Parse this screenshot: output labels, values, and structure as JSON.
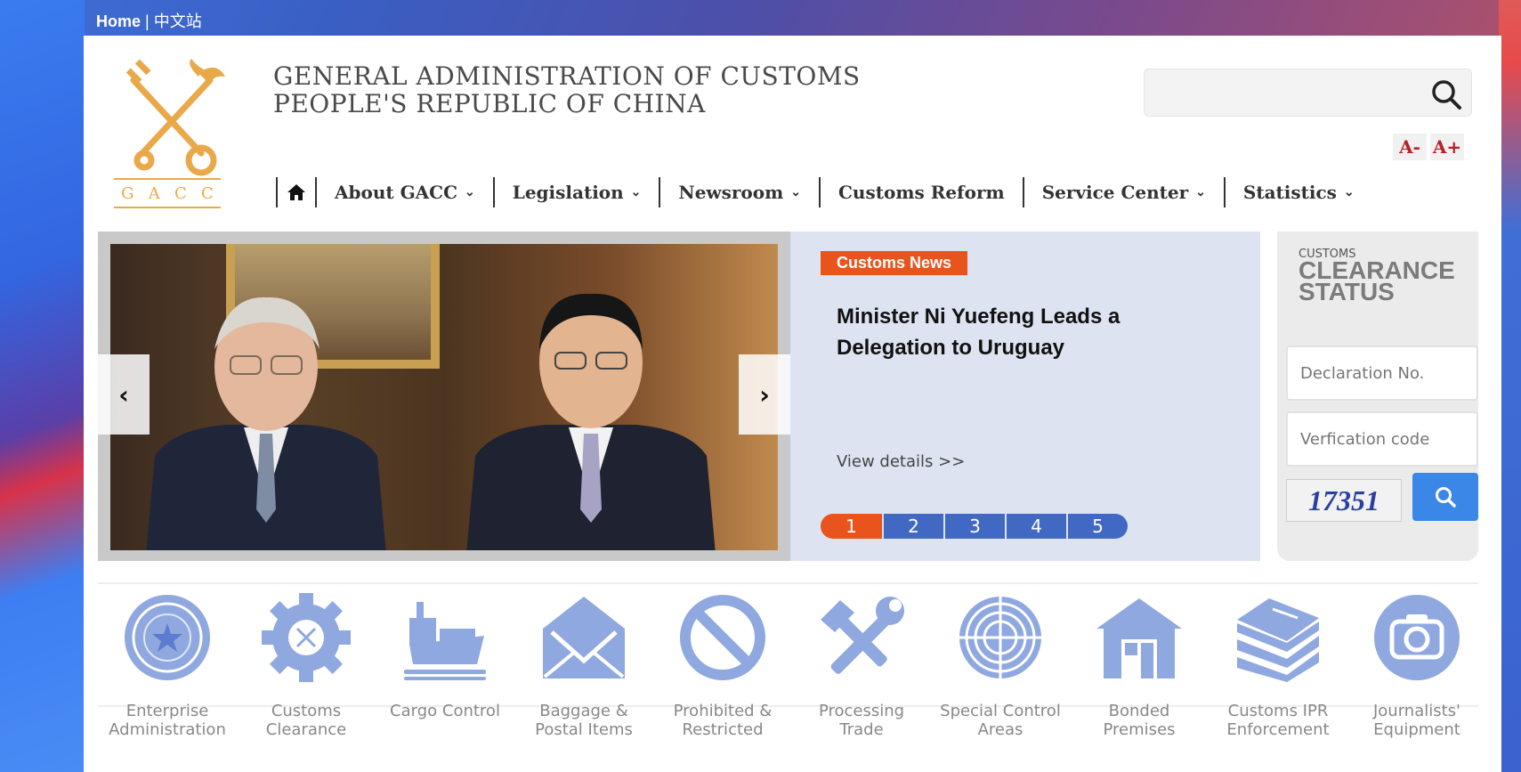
{
  "topbar": {
    "home": "Home",
    "separator": "|",
    "chinese_site": "中文站"
  },
  "header": {
    "org_line1": "GENERAL ADMINISTRATION OF CUSTOMS",
    "org_line2": "PEOPLE'S REPUBLIC OF CHINA",
    "logo_letters": [
      "G",
      "A",
      "C",
      "C"
    ],
    "search_placeholder": "",
    "font_decrease": "A-",
    "font_increase": "A+"
  },
  "nav": {
    "items": [
      {
        "label": "About GACC",
        "has_dropdown": true
      },
      {
        "label": "Legislation",
        "has_dropdown": true
      },
      {
        "label": "Newsroom",
        "has_dropdown": true
      },
      {
        "label": "Customs Reform",
        "has_dropdown": false
      },
      {
        "label": "Service Center",
        "has_dropdown": true
      },
      {
        "label": "Statistics",
        "has_dropdown": true
      }
    ]
  },
  "news": {
    "tag": "Customs News",
    "title": "Minister Ni Yuefeng Leads a Delegation to Uruguay",
    "more": "View details >>",
    "pages": [
      "1",
      "2",
      "3",
      "4",
      "5"
    ],
    "active_page": "1"
  },
  "clearance": {
    "small": "CUSTOMS",
    "big_line1": "CLEARANCE",
    "big_line2": "STATUS",
    "declaration_placeholder": "Declaration No.",
    "verification_placeholder": "Verfication code",
    "captcha": "17351"
  },
  "services": [
    {
      "line1": "Enterprise",
      "line2": "Administration",
      "icon": "star-badge-icon"
    },
    {
      "line1": "Customs",
      "line2": "Clearance",
      "icon": "gear-emblem-icon"
    },
    {
      "line1": "Cargo Control",
      "line2": "",
      "icon": "cargo-ship-icon"
    },
    {
      "line1": "Baggage &",
      "line2": "Postal Items",
      "icon": "envelope-icon"
    },
    {
      "line1": "Prohibited &",
      "line2": "Restricted",
      "icon": "prohibited-icon"
    },
    {
      "line1": "Processing",
      "line2": "Trade",
      "icon": "tools-icon"
    },
    {
      "line1": "Special Control",
      "line2": "Areas",
      "icon": "special-area-icon"
    },
    {
      "line1": "Bonded",
      "line2": "Premises",
      "icon": "warehouse-icon"
    },
    {
      "line1": "Customs IPR",
      "line2": "Enforcement",
      "icon": "books-icon"
    },
    {
      "line1": "Journalists'",
      "line2": "Equipment",
      "icon": "camera-icon"
    }
  ],
  "colors": {
    "accent_orange": "#e8541c",
    "accent_blue": "#4168c2",
    "icon_blue": "#8fa8e0",
    "logo_gold": "#e9a94a"
  }
}
